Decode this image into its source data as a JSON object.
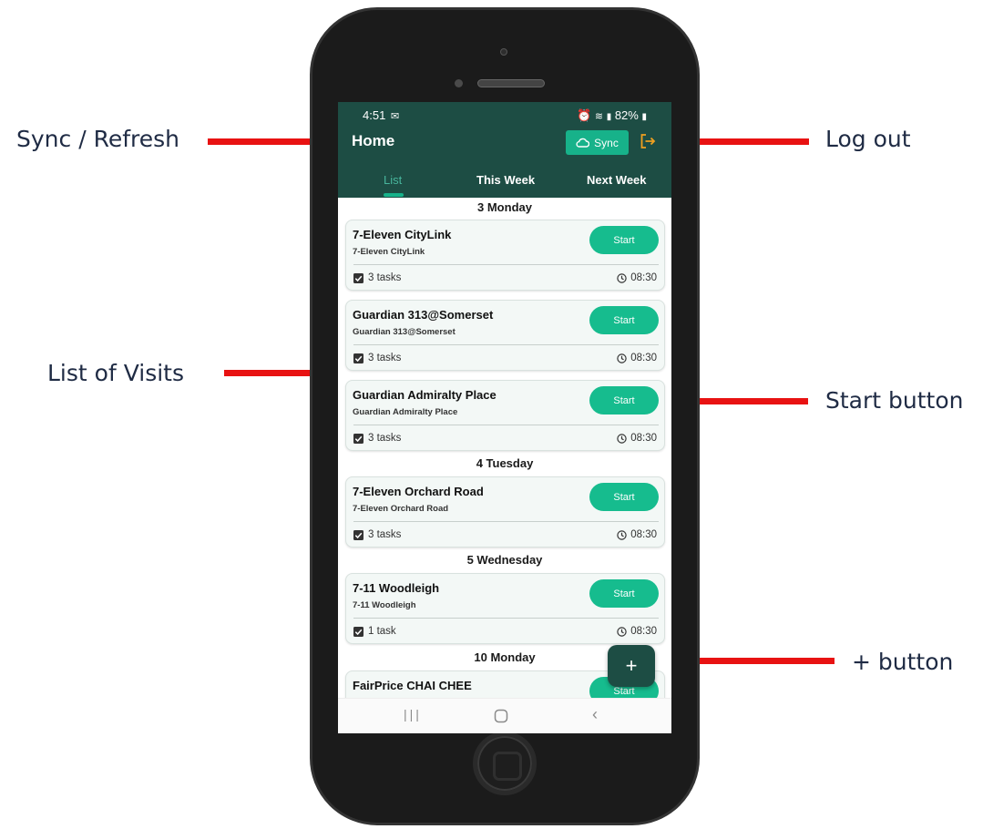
{
  "annotations": {
    "sync": "Sync / Refresh",
    "logout": "Log out",
    "list": "List of Visits",
    "start": "Start button",
    "plus": "+ button"
  },
  "status_bar": {
    "time": "4:51",
    "battery": "82%"
  },
  "app_bar": {
    "title": "Home",
    "sync_label": "Sync",
    "tabs": [
      {
        "label": "List",
        "active": true
      },
      {
        "label": "This Week",
        "active": false
      },
      {
        "label": "Next Week",
        "active": false
      }
    ]
  },
  "groups": [
    {
      "date": "3 Monday",
      "visits": [
        {
          "name": "7-Eleven CityLink",
          "subtitle": "7-Eleven CityLink",
          "start_label": "Start",
          "tasks": "3 tasks",
          "time": "08:30"
        },
        {
          "name": "Guardian 313@Somerset",
          "subtitle": "Guardian 313@Somerset",
          "start_label": "Start",
          "tasks": "3 tasks",
          "time": "08:30"
        },
        {
          "name": "Guardian Admiralty Place",
          "subtitle": "Guardian Admiralty Place",
          "start_label": "Start",
          "tasks": "3 tasks",
          "time": "08:30"
        }
      ]
    },
    {
      "date": "4 Tuesday",
      "visits": [
        {
          "name": "7-Eleven Orchard Road",
          "subtitle": "7-Eleven Orchard Road",
          "start_label": "Start",
          "tasks": "3 tasks",
          "time": "08:30"
        }
      ]
    },
    {
      "date": "5 Wednesday",
      "visits": [
        {
          "name": "7-11 Woodleigh",
          "subtitle": "7-11 Woodleigh",
          "start_label": "Start",
          "tasks": "1 task",
          "time": "08:30"
        }
      ]
    },
    {
      "date": "10 Monday",
      "visits": [
        {
          "name": "FairPrice CHAI CHEE",
          "subtitle": "",
          "start_label": "Start",
          "tasks": "",
          "time": ""
        }
      ]
    }
  ],
  "fab_label": "+",
  "colors": {
    "app_bar": "#1d4d44",
    "accent": "#16bc8e",
    "logout_icon": "#f0a020",
    "annotation_arrow": "#e81212"
  },
  "icons": [
    "cloud-icon",
    "logout-icon",
    "checkbox-icon",
    "clock-icon",
    "recent-apps-icon",
    "home-icon",
    "back-icon"
  ]
}
